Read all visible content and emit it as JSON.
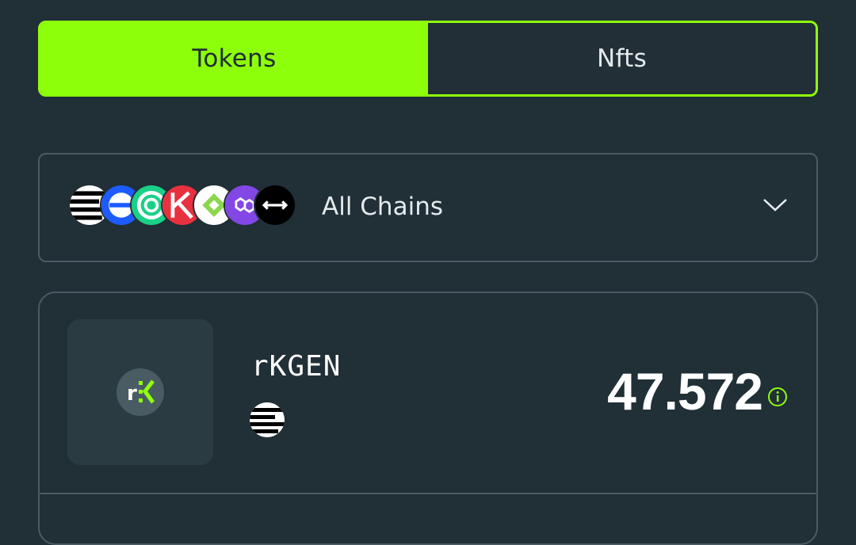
{
  "tabs": [
    {
      "label": "Tokens",
      "active": true
    },
    {
      "label": "Nfts",
      "active": false
    }
  ],
  "chain_selector": {
    "label": "All Chains",
    "icons": [
      "stripes-chain-icon",
      "blue-chain-icon",
      "green-ring-chain-icon",
      "red-k-chain-icon",
      "green-diamond-chain-icon",
      "polygon-chain-icon",
      "arrows-chain-icon"
    ],
    "dropdown_icon": "chevron-down-icon"
  },
  "tokens": [
    {
      "name": "rKGEN",
      "balance": "47.572",
      "logo": "rkgen-logo-icon",
      "chain_icon": "stripes-chain-icon",
      "info_icon": "info-icon"
    }
  ],
  "colors": {
    "background": "#212f36",
    "accent": "#8eff0b",
    "border": "#4a5b63"
  }
}
